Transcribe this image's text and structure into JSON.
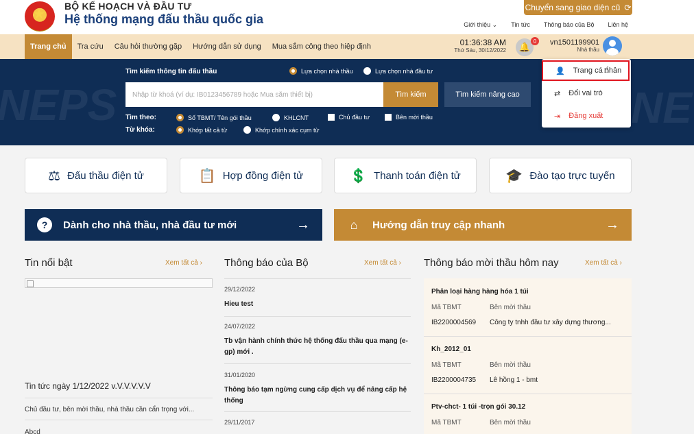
{
  "header": {
    "ministry": "BỘ KẾ HOẠCH VÀ ĐẦU TƯ",
    "system_title": "Hệ thống mạng đấu thầu quốc gia",
    "switch_ui": "Chuyển sang giao diện cũ",
    "top_links": [
      "Giới thiệu ⌄",
      "Tin tức",
      "Thông báo của Bộ",
      "Liên hệ"
    ]
  },
  "nav": {
    "items": [
      "Trang chủ",
      "Tra cứu",
      "Câu hỏi thường gặp",
      "Hướng dẫn sử dụng",
      "Mua sắm công theo hiệp định"
    ],
    "time": "01:36:38 AM",
    "date": "Thứ Sáu, 30/12/2022",
    "notif_count": "0",
    "user_id": "vn1501199901",
    "user_role": "Nhà thầu"
  },
  "search": {
    "heading": "Tìm kiếm thông tin đấu thầu",
    "mode_contractor": "Lựa chọn nhà thầu",
    "mode_investor": "Lựa chọn nhà đầu tư",
    "placeholder": "Nhập từ khoá (ví dụ: IB0123456789 hoặc Mua sắm thiết bị)",
    "search_button": "Tìm kiếm",
    "advanced_button": "Tìm kiếm nâng cao",
    "search_by_label": "Tìm theo:",
    "by_options": [
      "Số TBMT/ Tên gói thầu",
      "KHLCNT",
      "Chủ đầu tư",
      "Bên mời thầu"
    ],
    "keyword_label": "Từ khóa:",
    "keyword_options": [
      "Khớp tất cả từ",
      "Khớp chính xác cụm từ"
    ],
    "watermark": "NEPS",
    "watermark_right": "NE"
  },
  "dropdown": {
    "profile": "Trang cá nhân",
    "switch_role": "Đổi vai trò",
    "logout": "Đăng xuất"
  },
  "cards": [
    "Đấu thầu điện tử",
    "Hợp đồng điện tử",
    "Thanh toán điện tử",
    "Đào tạo trực tuyến"
  ],
  "banners": {
    "new_users": "Dành cho nhà thầu, nhà đầu tư mới",
    "quick_guide": "Hướng dẫn truy cập nhanh"
  },
  "columns": {
    "see_all": "Xem tất cả",
    "featured_title": "Tin nổi bật",
    "ministry_title": "Thông báo của Bộ",
    "tender_title": "Thông báo mời thầu hôm nay"
  },
  "featured": {
    "news_title": "Tin tức ngày 1/12/2022 v.V.V.V.V.V",
    "news_desc": "Chủ đầu tư, bên mời thầu, nhà thầu cần cẩn trọng với...",
    "next_title": "Abcd"
  },
  "notices": [
    {
      "date": "29/12/2022",
      "title": "Hieu test"
    },
    {
      "date": "24/07/2022",
      "title": "Tb vận hành chính thức hệ thống đấu thầu qua mạng (e-gp) mới ."
    },
    {
      "date": "31/01/2020",
      "title": "Thông báo tạm ngừng cung cấp dịch vụ để nâng cấp hệ thống"
    },
    {
      "date": "29/11/2017",
      "title": ""
    }
  ],
  "tenders": {
    "label_code": "Mã TBMT",
    "label_inviter": "Bên mời thầu",
    "items": [
      {
        "title": "Phân loại hàng hàng hóa 1 túi",
        "code": "IB2200004569",
        "inviter": "Công ty tnhh đầu tư xây dựng thương..."
      },
      {
        "title": "Kh_2012_01",
        "code": "IB2200004735",
        "inviter": "Lê hồng 1 - bmt"
      },
      {
        "title": "Ptv-chct- 1 túi -trọn gói 30.12",
        "code": "",
        "inviter": ""
      }
    ]
  }
}
